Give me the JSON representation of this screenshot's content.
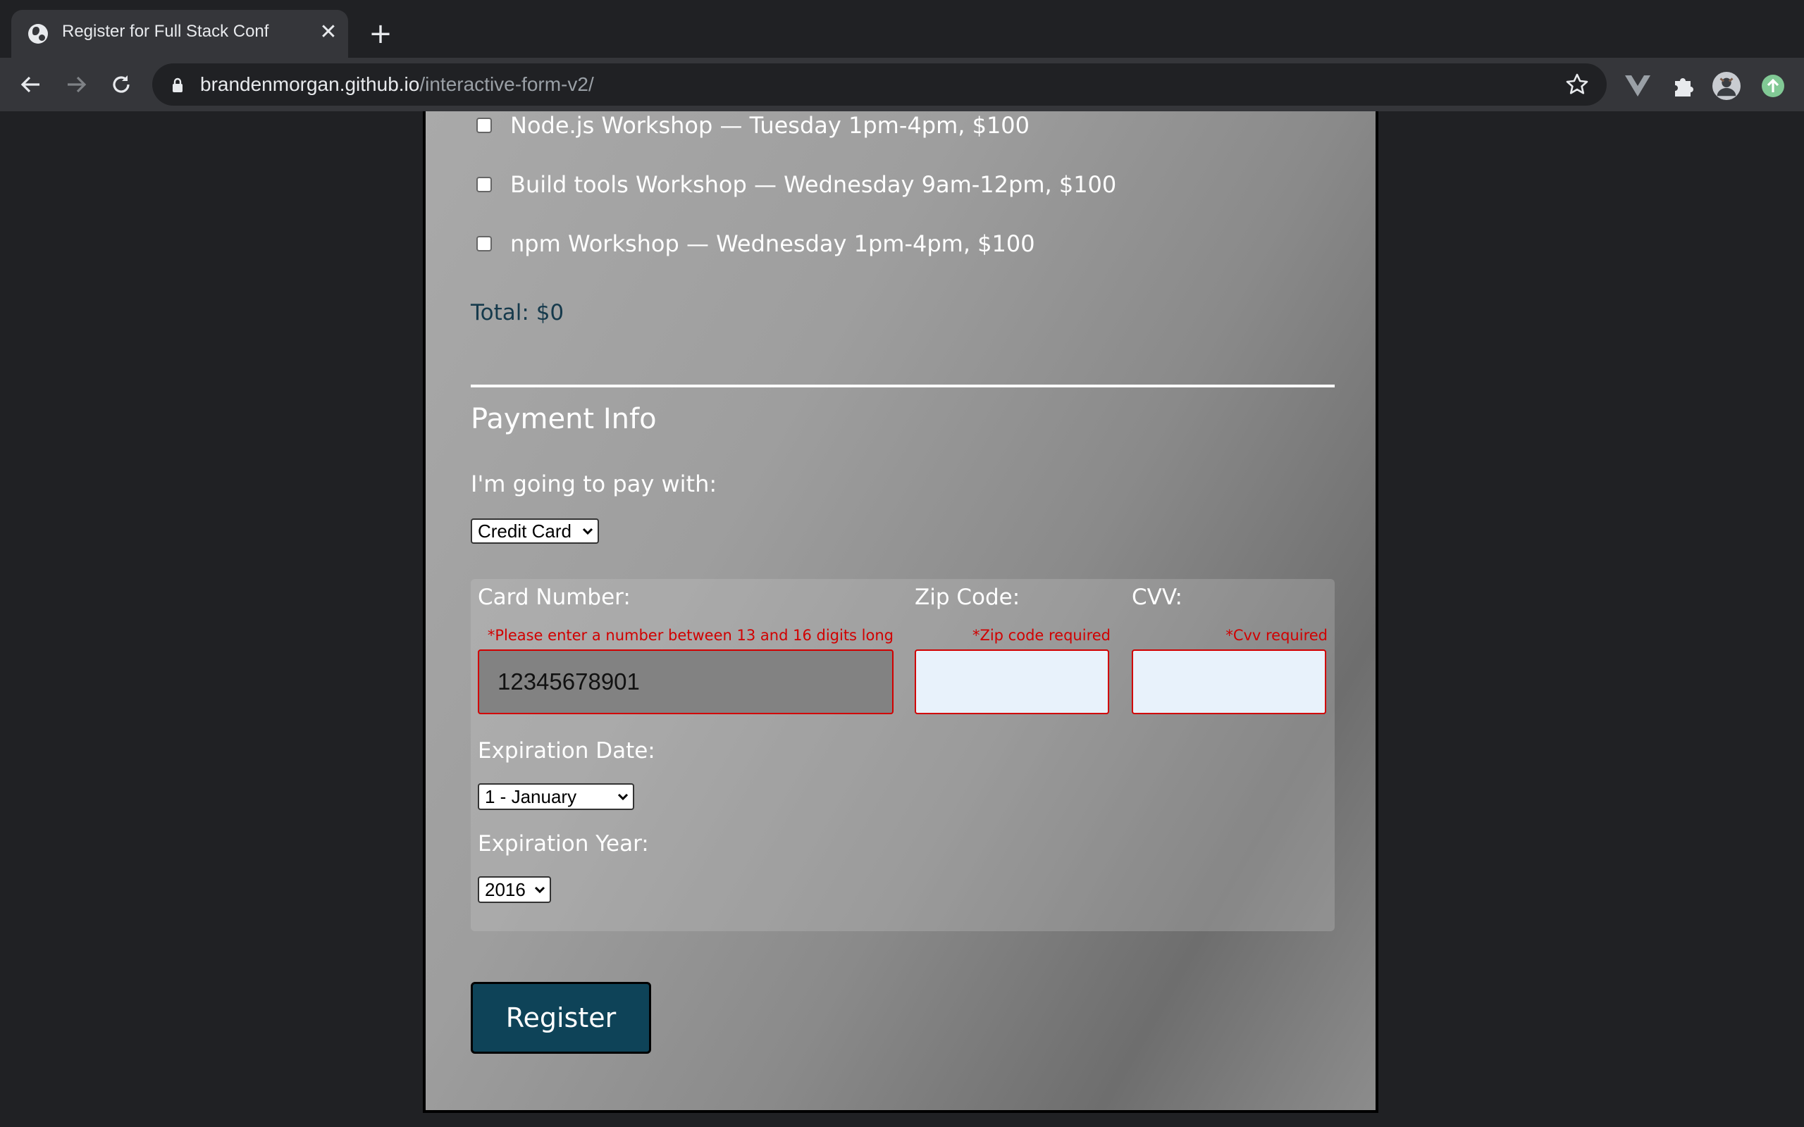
{
  "browser": {
    "tab_title": "Register for Full Stack Conf",
    "url_host": "brandenmorgan.github.io",
    "url_path": "/interactive-form-v2/"
  },
  "activities": {
    "items": [
      {
        "label": "Node.js Workshop — Tuesday 1pm-4pm, $100",
        "checked": false
      },
      {
        "label": "Build tools Workshop — Wednesday 9am-12pm, $100",
        "checked": false
      },
      {
        "label": "npm Workshop — Wednesday 1pm-4pm, $100",
        "checked": false
      }
    ],
    "total": "Total: $0"
  },
  "payment": {
    "section_title": "Payment Info",
    "method_label": "I'm going to pay with:",
    "method_value": "Credit Card",
    "card_number_label": "Card Number:",
    "card_number_error": "*Please enter a number between 13 and 16 digits long",
    "card_number_value": "12345678901",
    "zip_label": "Zip Code:",
    "zip_error": "*Zip code required",
    "zip_value": "",
    "cvv_label": "CVV:",
    "cvv_error": "*Cvv required",
    "cvv_value": "",
    "exp_date_label": "Expiration Date:",
    "exp_date_value": "1 - January",
    "exp_year_label": "Expiration Year:",
    "exp_year_value": "2016"
  },
  "register_label": "Register",
  "colors": {
    "register_bg": "#0e4358",
    "error_red": "#d10000",
    "total_text": "#163a4c"
  }
}
